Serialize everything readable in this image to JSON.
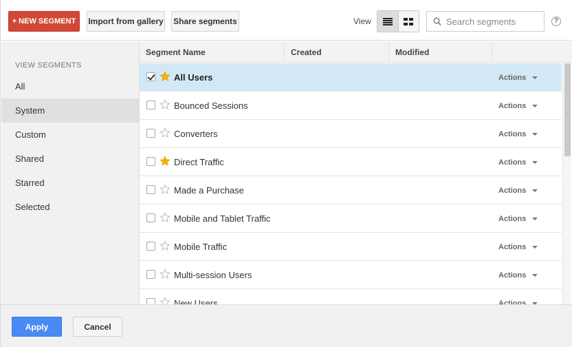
{
  "toolbar": {
    "new_segment_label": "+ NEW SEGMENT",
    "import_label": "Import from gallery",
    "share_label": "Share segments",
    "view_label": "View",
    "view_modes": [
      "list-view-icon",
      "grid-view-icon"
    ],
    "active_view": "list",
    "search_placeholder": "Search segments",
    "help_label": "?"
  },
  "sidebar": {
    "heading": "VIEW SEGMENTS",
    "items": [
      {
        "label": "All",
        "active": false
      },
      {
        "label": "System",
        "active": true
      },
      {
        "label": "Custom",
        "active": false
      },
      {
        "label": "Shared",
        "active": false
      },
      {
        "label": "Starred",
        "active": false
      },
      {
        "label": "Selected",
        "active": false
      }
    ]
  },
  "table": {
    "columns": [
      "Segment Name",
      "Created",
      "Modified"
    ],
    "actions_label": "Actions",
    "rows": [
      {
        "name": "All Users",
        "checked": true,
        "starred": true,
        "selected": true
      },
      {
        "name": "Bounced Sessions",
        "checked": false,
        "starred": false,
        "selected": false
      },
      {
        "name": "Converters",
        "checked": false,
        "starred": false,
        "selected": false
      },
      {
        "name": "Direct Traffic",
        "checked": false,
        "starred": true,
        "selected": false
      },
      {
        "name": "Made a Purchase",
        "checked": false,
        "starred": false,
        "selected": false
      },
      {
        "name": "Mobile and Tablet Traffic",
        "checked": false,
        "starred": false,
        "selected": false
      },
      {
        "name": "Mobile Traffic",
        "checked": false,
        "starred": false,
        "selected": false
      },
      {
        "name": "Multi-session Users",
        "checked": false,
        "starred": false,
        "selected": false
      },
      {
        "name": "New Users",
        "checked": false,
        "starred": false,
        "selected": false
      }
    ]
  },
  "footer": {
    "apply_label": "Apply",
    "cancel_label": "Cancel"
  },
  "colors": {
    "new_segment": "#d14836",
    "apply": "#4a8af4",
    "selected_row": "#d2e8f7",
    "star_filled": "#f4b400"
  }
}
